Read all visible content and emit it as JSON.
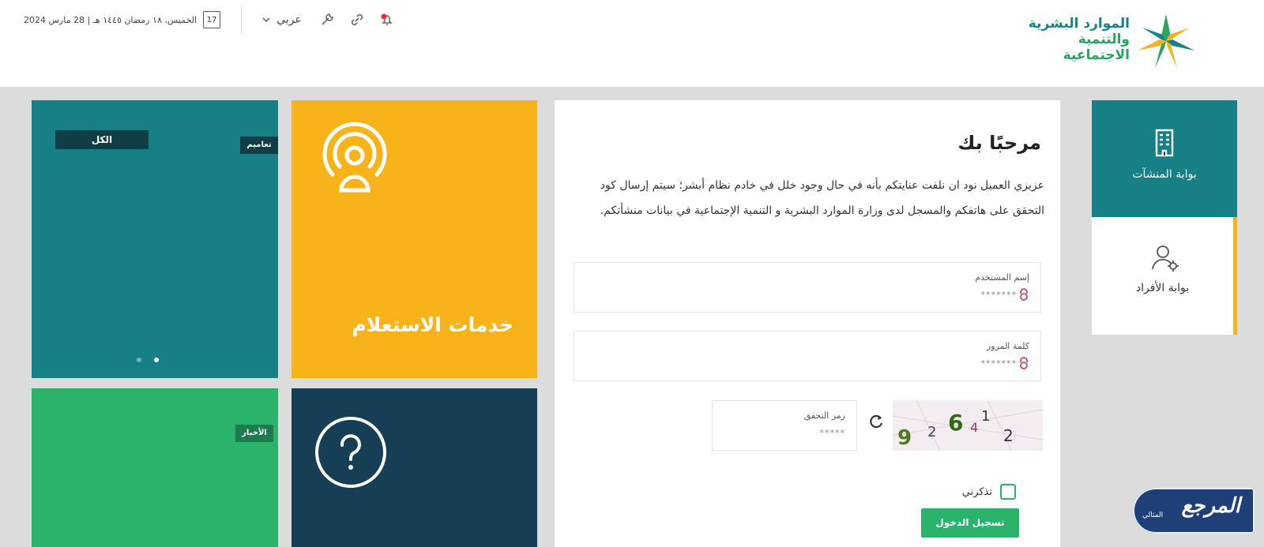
{
  "header": {
    "logo": {
      "line1": "الموارد البشرية",
      "line2": "والتنمية الاجتماعية"
    },
    "date_text": "الخميس، ١٨ رمضان ١٤٤٥ هـ | 28 مارس 2024",
    "calendar_day": "17",
    "language": "عربي"
  },
  "tiles": {
    "tag_all": "الكل",
    "tag_circulars": "تعاميم",
    "tag_news": "الأخبار",
    "inquiry_title": "خدمات الاستعلام"
  },
  "login": {
    "welcome": "مرحبًا بك",
    "notice": "عزيزي العميل نود ان نلفت عنايتكم بأنه في حال وجود خلل في خادم نظام أبشر؛ سيتم إرسال كود التحقق على هاتفكم والمسجل لدى وزارة الموارد البشرية و التنمية الإجتماعية في بيانات منشأتكم.",
    "username_label": "إسم المستخدم",
    "username_value": "*******",
    "password_label": "كلمة المرور",
    "password_value": "*******",
    "captcha_label": "رمز التحقق",
    "captcha_value": "*****",
    "captcha_image_text": "926412",
    "remember_label": "تذكرني",
    "submit_label": "تسجيل الدخول"
  },
  "portals": {
    "establishments": "بوابة المنشآت",
    "individuals": "بوابة الأفراد"
  },
  "watermark": {
    "main": "المرجع",
    "sub": "المثالي"
  },
  "colors": {
    "teal": "#177f86",
    "yellow": "#f9b31a",
    "green": "#2cb36b",
    "navy": "#163f56"
  }
}
